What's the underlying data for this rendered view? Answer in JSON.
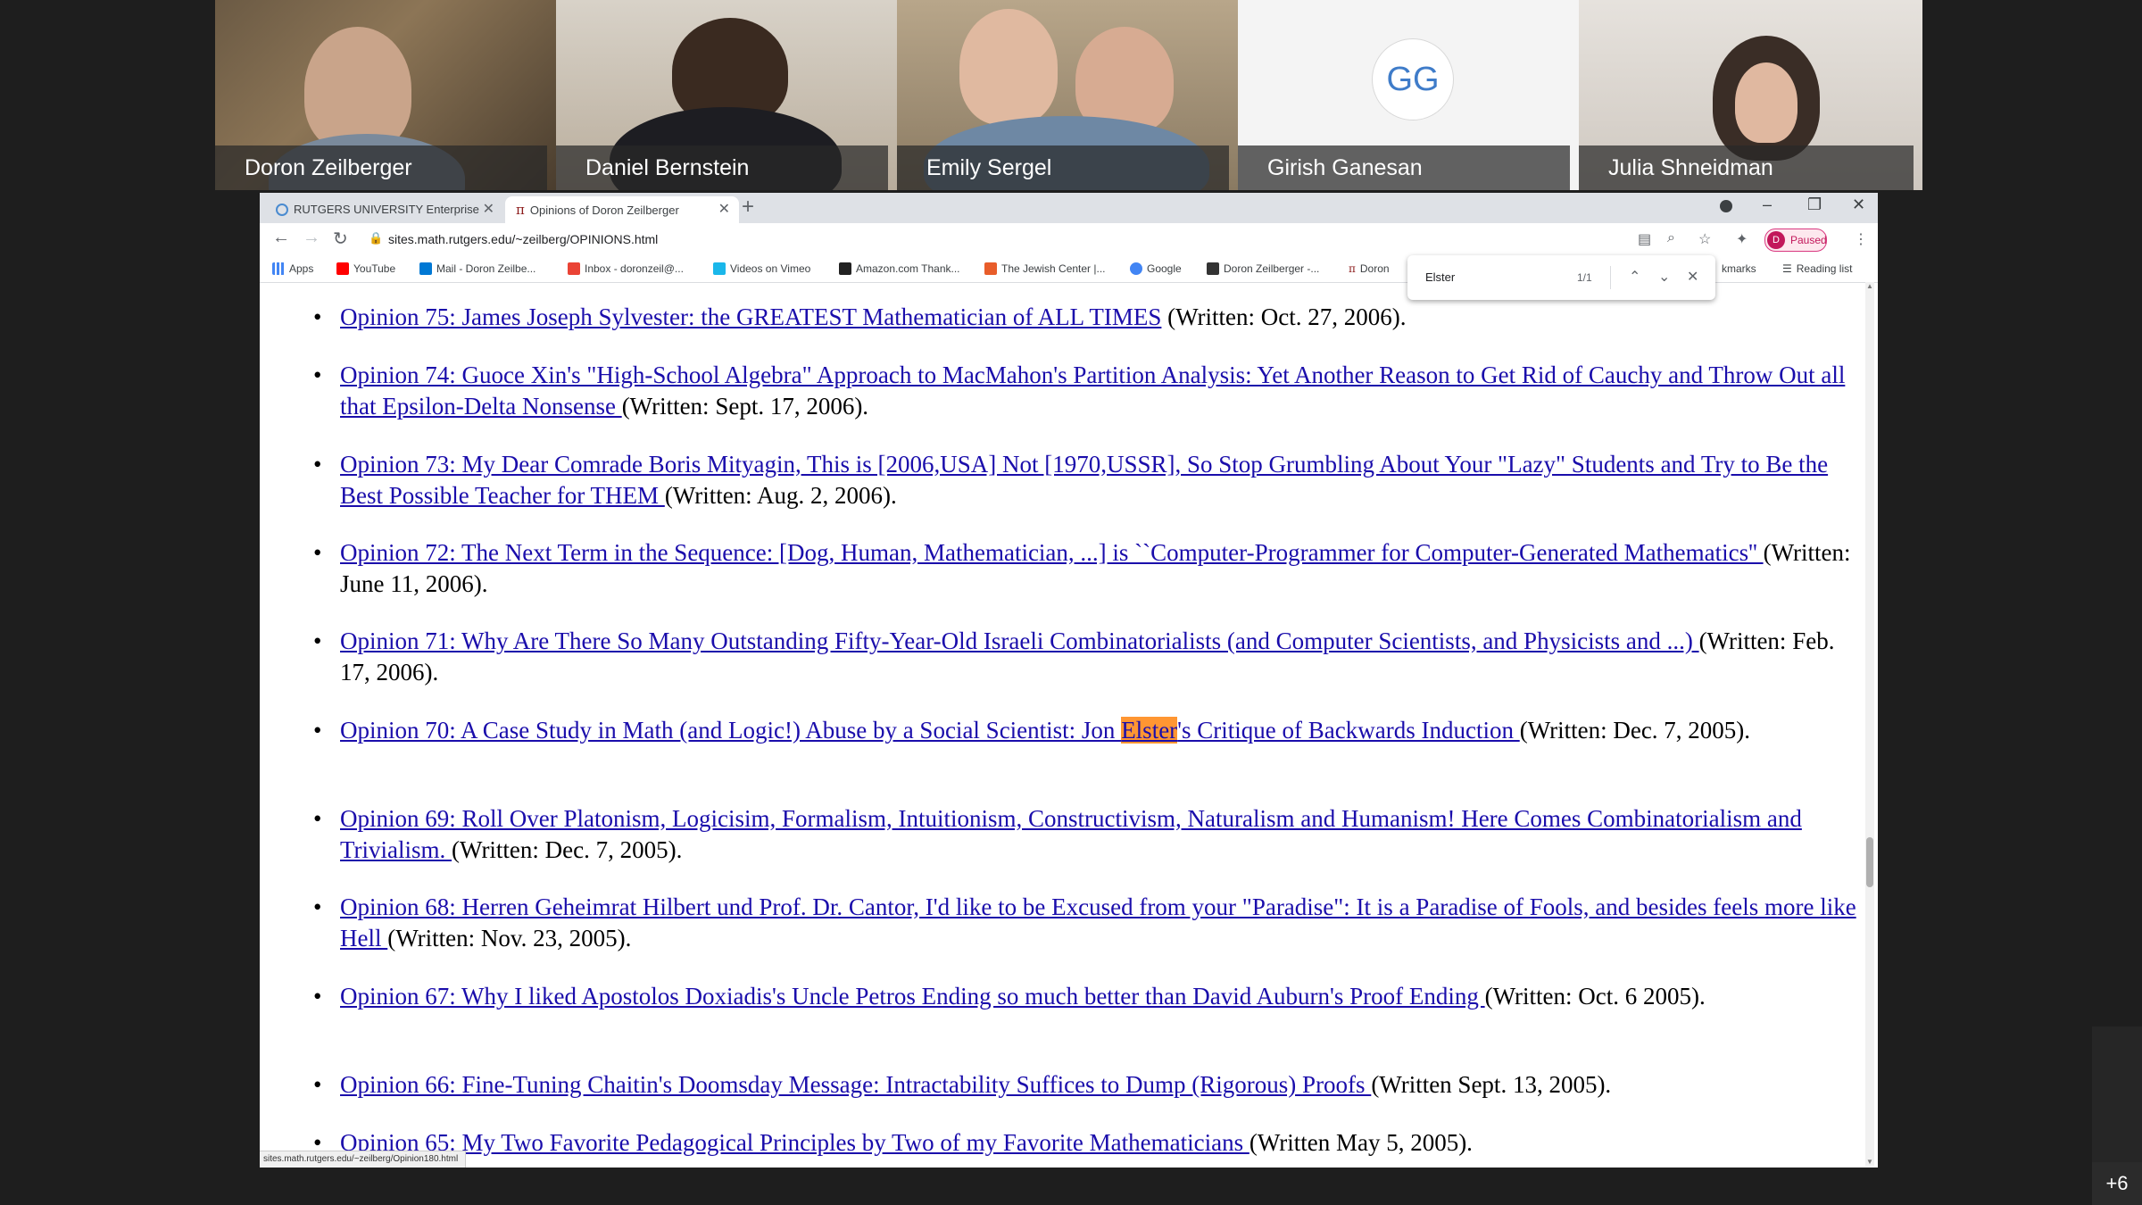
{
  "participants": [
    {
      "name": "Doron Zeilberger"
    },
    {
      "name": "Daniel Bernstein"
    },
    {
      "name": "Emily Sergel"
    },
    {
      "name": "Girish Ganesan",
      "initials": "GG"
    },
    {
      "name": "Julia Shneidman"
    }
  ],
  "more_participants": "+6",
  "browser": {
    "tabs": [
      {
        "label": "RUTGERS UNIVERSITY Enterprise",
        "icon": "globe-icon",
        "active": false
      },
      {
        "label": "Opinions of Doron Zeilberger",
        "icon": "pi-icon",
        "active": true
      }
    ],
    "url": "sites.math.rutgers.edu/~zeilberg/OPINIONS.html",
    "profile_label": "Paused",
    "profile_initial": "D",
    "bookmarks": [
      {
        "label": "Apps",
        "icon": "apps-grid-icon",
        "color": "#4285f4"
      },
      {
        "label": "YouTube",
        "icon": "youtube-icon",
        "color": "#ff0000"
      },
      {
        "label": "Mail - Doron Zeilbe...",
        "icon": "outlook-icon",
        "color": "#0078d4"
      },
      {
        "label": "Inbox - doronzeil@...",
        "icon": "gmail-icon",
        "color": "#ea4335"
      },
      {
        "label": "Videos on Vimeo",
        "icon": "vimeo-icon",
        "color": "#1ab7ea"
      },
      {
        "label": "Amazon.com Thank...",
        "icon": "amazon-icon",
        "color": "#222222"
      },
      {
        "label": "The Jewish Center |...",
        "icon": "jewish-center-icon",
        "color": "#e85d2a"
      },
      {
        "label": "Google",
        "icon": "google-icon",
        "color": "#4285f4"
      },
      {
        "label": "Doron Zeilberger -...",
        "icon": "wikipedia-icon",
        "color": "#333333"
      },
      {
        "label": "Doron",
        "icon": "pi-icon",
        "color": "#8b1a1a"
      }
    ],
    "bookmarks_other": "kmarks",
    "reading_list": "Reading list",
    "find": {
      "query": "Elster",
      "count": "1/1"
    },
    "status_url": "sites.math.rutgers.edu/~zeilberg/Opinion180.html"
  },
  "opinions": [
    {
      "link": "Opinion 75: James Joseph Sylvester: the GREATEST Mathematician of ALL TIMES",
      "written": " (Written: Oct. 27, 2006)."
    },
    {
      "link": "Opinion 74: Guoce Xin's \"High-School Algebra\" Approach to MacMahon's Partition Analysis: Yet Another Reason to Get Rid of Cauchy and Throw Out all that Epsilon-Delta Nonsense ",
      "written": "(Written: Sept. 17, 2006)."
    },
    {
      "link": "Opinion 73: My Dear Comrade Boris Mityagin, This is [2006,USA] Not [1970,USSR], So Stop Grumbling About Your \"Lazy\" Students and Try to Be the Best Possible Teacher for THEM ",
      "written": "(Written: Aug. 2, 2006)."
    },
    {
      "link": "Opinion 72: The Next Term in the Sequence: [Dog, Human, Mathematician, ...] is ``Computer-Programmer for Computer-Generated Mathematics'' ",
      "written": "(Written: June 11, 2006)."
    },
    {
      "link": "Opinion 71: Why Are There So Many Outstanding Fifty-Year-Old Israeli Combinatorialists (and Computer Scientists, and Physicists and ...) ",
      "written": "(Written: Feb. 17, 2006)."
    },
    {
      "link_pre": "Opinion 70: A Case Study in Math (and Logic!) Abuse by a Social Scientist: Jon ",
      "link_hl": "Elster",
      "link_post": "'s Critique of Backwards Induction ",
      "written": "(Written: Dec. 7, 2005)."
    },
    {
      "link": "Opinion 69: Roll Over Platonism, Logicisim, Formalism, Intuitionism, Constructivism, Naturalism and Humanism! Here Comes Combinatorialism and Trivialism. ",
      "written": "(Written: Dec. 7, 2005)."
    },
    {
      "link": "Opinion 68: Herren Geheimrat Hilbert und Prof. Dr. Cantor, I'd like to be Excused from your \"Paradise\": It is a Paradise of Fools, and besides feels more like Hell ",
      "written": "(Written: Nov. 23, 2005)."
    },
    {
      "link": "Opinion 67: Why I liked Apostolos Doxiadis's Uncle Petros Ending so much better than David Auburn's Proof Ending ",
      "written": "(Written: Oct. 6 2005)."
    },
    {
      "link": "Opinion 66: Fine-Tuning Chaitin's Doomsday Message: Intractability Suffices to Dump (Rigorous) Proofs ",
      "written": "(Written Sept. 13, 2005)."
    },
    {
      "link": "Opinion 65: My Two Favorite Pedagogical Principles by Two of my Favorite Mathematicians ",
      "written": "(Written May 5, 2005)."
    }
  ]
}
